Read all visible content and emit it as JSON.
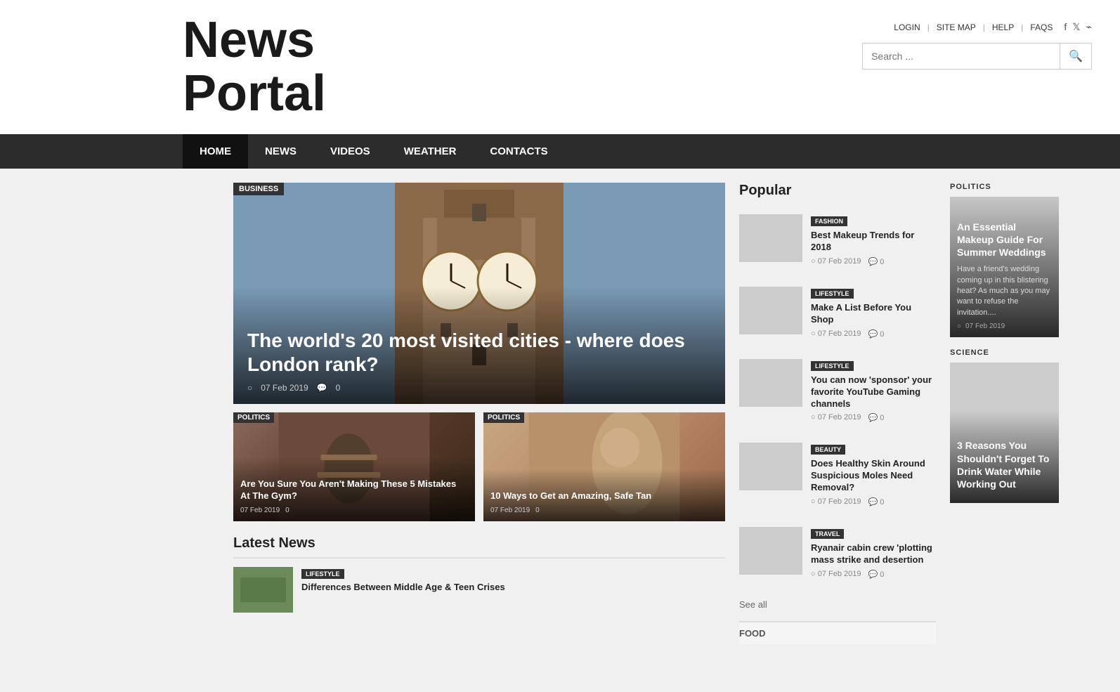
{
  "site": {
    "title_line1": "News",
    "title_line2": "Portal"
  },
  "header": {
    "links": [
      "LOGIN",
      "SITE MAP",
      "HELP",
      "FAQS"
    ],
    "search_placeholder": "Search ..."
  },
  "nav": {
    "items": [
      "HOME",
      "NEWS",
      "VIDEOS",
      "WEATHER",
      "CONTACTS"
    ],
    "active": "HOME"
  },
  "featured": {
    "tag": "BUSINESS",
    "title": "The world's 20 most visited cities - where does London rank?",
    "date": "07 Feb 2019",
    "comments": "0"
  },
  "small_cards": [
    {
      "tag": "POLITICS",
      "title": "Are You Sure You Aren't Making These 5 Mistakes At The Gym?",
      "date": "07 Feb 2019",
      "comments": "0"
    },
    {
      "tag": "POLITICS",
      "title": "10 Ways to Get an Amazing, Safe Tan",
      "date": "07 Feb 2019",
      "comments": "0"
    }
  ],
  "latest_news": {
    "section_label": "Latest News",
    "items": [
      {
        "tag": "LIFESTYLE",
        "title": "Differences Between Middle Age & Teen Crises",
        "thumb_class": "lifestyle"
      }
    ]
  },
  "popular": {
    "section_label": "Popular",
    "items": [
      {
        "tag": "FASHION",
        "title": "Best Makeup Trends for 2018",
        "date": "07 Feb 2019",
        "comments": "0",
        "thumb_class": "fashion"
      },
      {
        "tag": "LIFESTYLE",
        "title": "Make A List Before You Shop",
        "date": "07 Feb 2019",
        "comments": "0",
        "thumb_class": "lifestyle1"
      },
      {
        "tag": "LIFESTYLE",
        "title": "You can now 'sponsor' your favorite YouTube Gaming channels",
        "date": "07 Feb 2019",
        "comments": "0",
        "thumb_class": "lifestyle2"
      },
      {
        "tag": "BEAUTY",
        "title": "Does Healthy Skin Around Suspicious Moles Need Removal?",
        "date": "07 Feb 2019",
        "comments": "0",
        "thumb_class": "beauty"
      },
      {
        "tag": "TRAVEL",
        "title": "Ryanair cabin crew 'plotting mass strike and desertion",
        "date": "07 Feb 2019",
        "comments": "0",
        "thumb_class": "travel"
      }
    ],
    "see_all": "See all"
  },
  "food_label": "FOOD",
  "right_sidebar": {
    "sections": [
      {
        "label": "POLITICS",
        "article_title": "An Essential Makeup Guide For Summer Weddings",
        "excerpt": "Have a friend's wedding coming up in this blistering heat? As much as you may want to refuse the invitation....",
        "date": "07 Feb 2019",
        "img_class": "politics-img"
      },
      {
        "label": "SCIENCE",
        "article_title": "3 Reasons You Shouldn't Forget To Drink Water While Working Out",
        "excerpt": "",
        "date": "",
        "img_class": "science-img"
      }
    ]
  }
}
